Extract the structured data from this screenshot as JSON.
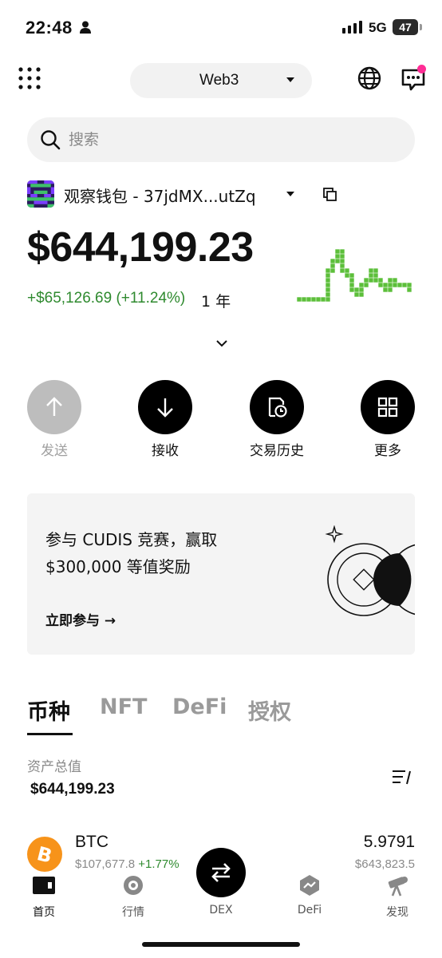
{
  "status_bar": {
    "time": "22:48",
    "network": "5G",
    "battery": "47"
  },
  "header": {
    "network_selector": "Web3"
  },
  "search": {
    "placeholder": "搜索"
  },
  "wallet": {
    "name": "观察钱包 - 37jdMX...utZq",
    "balance": "$644,199.23",
    "change": "+$65,126.69 (+11.24%)",
    "period": "1 年",
    "sparkline_levels": [
      0.05,
      0.05,
      0.08,
      0.05,
      0.12,
      0.12,
      0.55,
      0.72,
      0.95,
      0.6,
      0.5,
      0.25,
      0.15,
      0.35,
      0.45,
      0.55,
      0.42,
      0.3,
      0.28,
      0.4,
      0.36,
      0.32,
      0.34,
      0.25
    ],
    "sparkline_color": "#5cbf3a"
  },
  "actions": [
    {
      "label": "发送",
      "icon": "arrow-up-icon",
      "enabled": false
    },
    {
      "label": "接收",
      "icon": "arrow-down-icon",
      "enabled": true
    },
    {
      "label": "交易历史",
      "icon": "history-icon",
      "enabled": true
    },
    {
      "label": "更多",
      "icon": "grid-icon",
      "enabled": true
    }
  ],
  "promo": {
    "line1": "参与 CUDIS 竞赛，赢取",
    "line2": "$300,000 等值奖励",
    "cta": "立即参与 →"
  },
  "tabs": [
    {
      "label": "币种",
      "active": true
    },
    {
      "label": "NFT",
      "active": false
    },
    {
      "label": "DeFi",
      "active": false
    },
    {
      "label": "授权",
      "active": false
    }
  ],
  "assets_summary": {
    "label": "资产总值",
    "value": "$644,199.23"
  },
  "assets": [
    {
      "symbol": "BTC",
      "price": "$107,677.8",
      "change": "+1.77%",
      "amount": "5.9791",
      "value": "$643,823.5",
      "icon": "bitcoin-icon",
      "color": "#f7931a"
    }
  ],
  "bottom_nav": [
    {
      "label": "首页",
      "icon": "wallet-icon",
      "active": true
    },
    {
      "label": "行情",
      "icon": "market-icon",
      "active": false
    },
    {
      "label": "DEX",
      "icon": "swap-icon",
      "active": false
    },
    {
      "label": "DeFi",
      "icon": "defi-icon",
      "active": false
    },
    {
      "label": "发现",
      "icon": "telescope-icon",
      "active": false
    }
  ],
  "colors": {
    "accent": "#000000",
    "positive": "#2f8a2f",
    "notification": "#ff2d95",
    "surface": "#f2f2f2"
  }
}
